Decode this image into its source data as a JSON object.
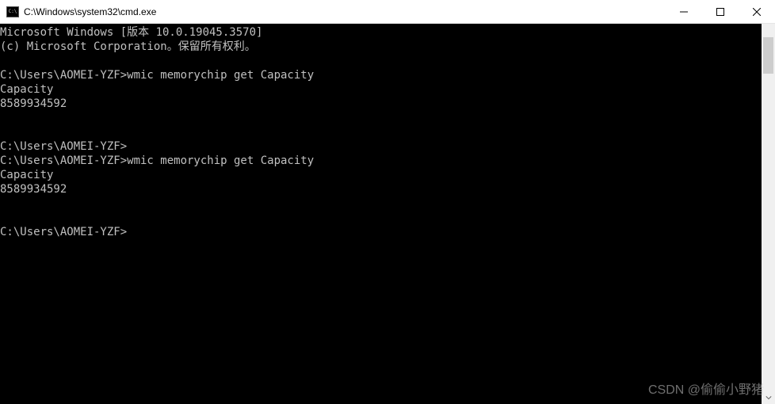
{
  "window": {
    "title": "C:\\Windows\\system32\\cmd.exe"
  },
  "terminal": {
    "lines": [
      "Microsoft Windows [版本 10.0.19045.3570]",
      "(c) Microsoft Corporation。保留所有权利。",
      "",
      "C:\\Users\\AOMEI-YZF>wmic memorychip get Capacity",
      "Capacity",
      "8589934592",
      "",
      "",
      "C:\\Users\\AOMEI-YZF>",
      "C:\\Users\\AOMEI-YZF>wmic memorychip get Capacity",
      "Capacity",
      "8589934592",
      "",
      "",
      "C:\\Users\\AOMEI-YZF>"
    ],
    "content": "Microsoft Windows [版本 10.0.19045.3570]\n(c) Microsoft Corporation。保留所有权利。\n\nC:\\Users\\AOMEI-YZF>wmic memorychip get Capacity\nCapacity\n8589934592\n\n\nC:\\Users\\AOMEI-YZF>\nC:\\Users\\AOMEI-YZF>wmic memorychip get Capacity\nCapacity\n8589934592\n\n\nC:\\Users\\AOMEI-YZF>"
  },
  "watermark": "CSDN @偷偷小野猪"
}
